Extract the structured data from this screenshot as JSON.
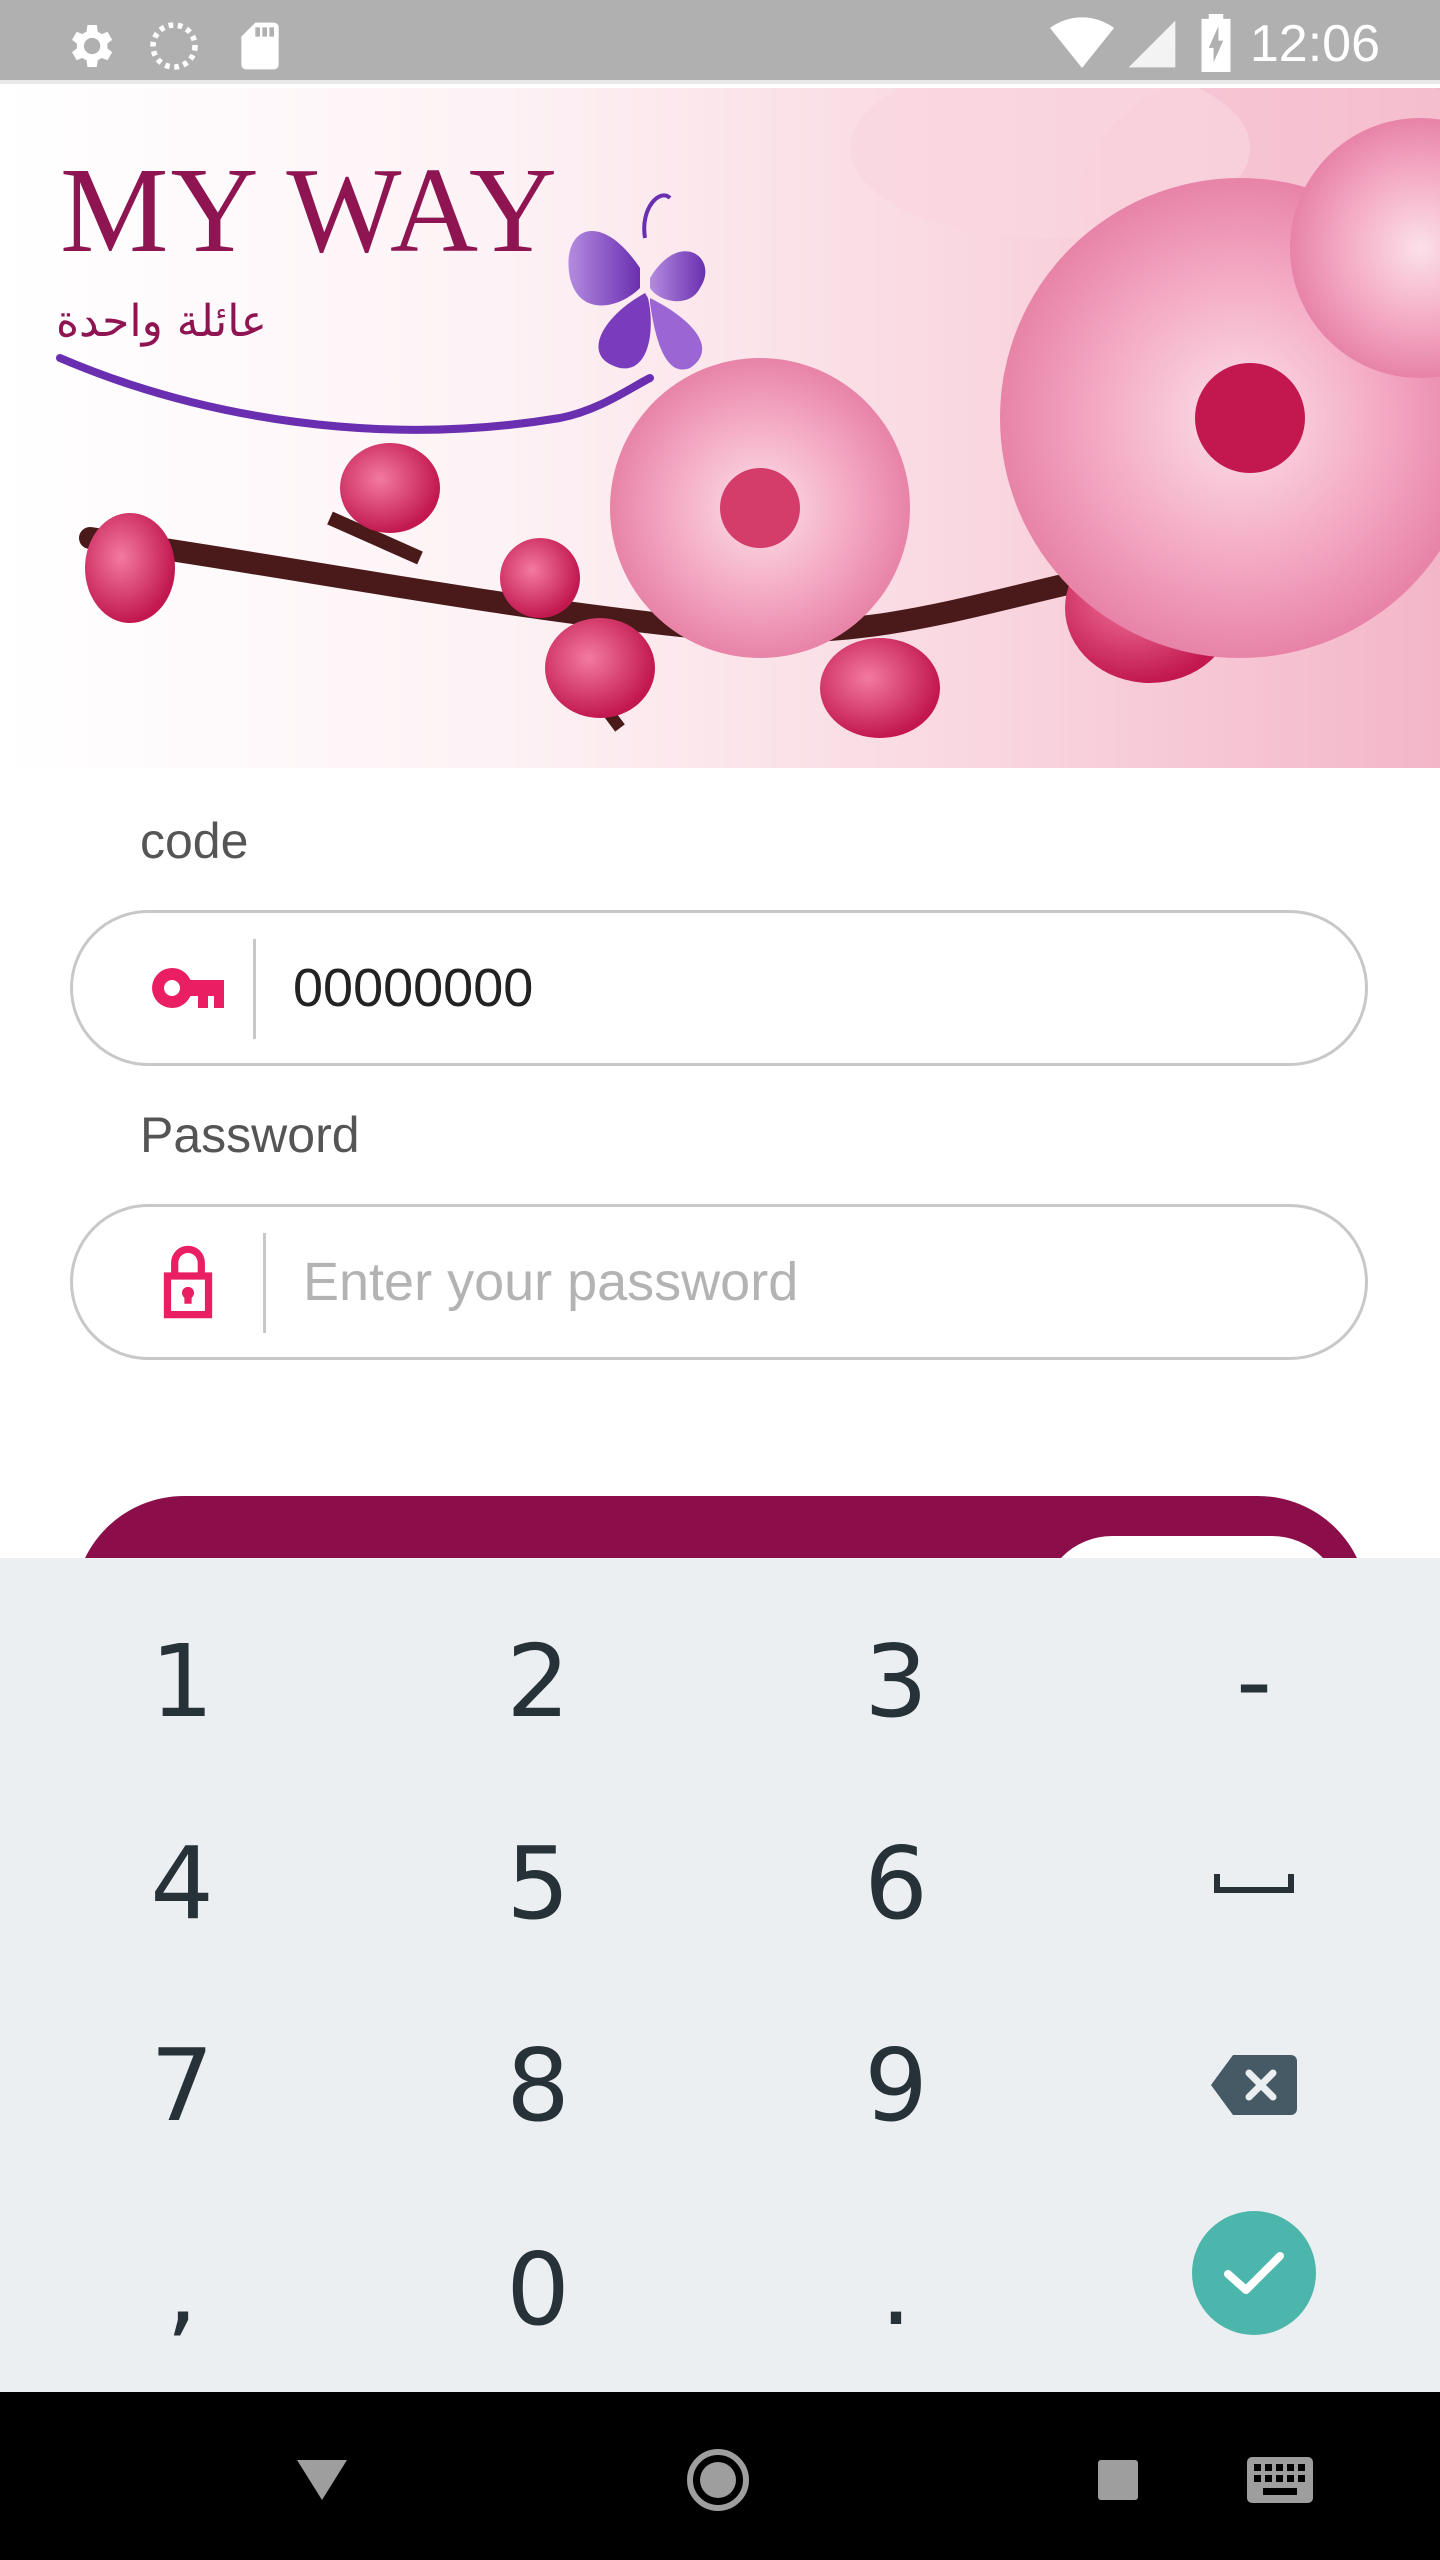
{
  "status_bar": {
    "time": "12:06",
    "left_icons": [
      "settings-icon",
      "loading-icon",
      "sd-card-icon"
    ],
    "right_icons": [
      "wifi-icon",
      "signal-icon",
      "battery-charging-icon"
    ]
  },
  "brand": {
    "title": "MY WAY",
    "tagline": "عائلة واحدة",
    "color": "#8e1452"
  },
  "form": {
    "code_label": "code",
    "code_value": "00000000",
    "code_icon": "key-icon",
    "password_label": "Password",
    "password_placeholder": "Enter your password",
    "password_icon": "lock-icon",
    "accent_color": "#e91e63",
    "button_color": "#8b0e4b"
  },
  "keyboard": {
    "keys": [
      "1",
      "2",
      "3",
      "-",
      "4",
      "5",
      "6",
      "space",
      "7",
      "8",
      "9",
      "backspace",
      ",",
      "0",
      ".",
      "done"
    ],
    "row1": [
      "1",
      "2",
      "3",
      "-"
    ],
    "row2": [
      "4",
      "5",
      "6"
    ],
    "row3": [
      "7",
      "8",
      "9"
    ],
    "row4": [
      ",",
      "0",
      "."
    ],
    "done_color": "#4db6ac"
  },
  "nav_bar": {
    "buttons": [
      "back-icon",
      "home-icon",
      "recents-icon",
      "keyboard-switch-icon"
    ]
  }
}
